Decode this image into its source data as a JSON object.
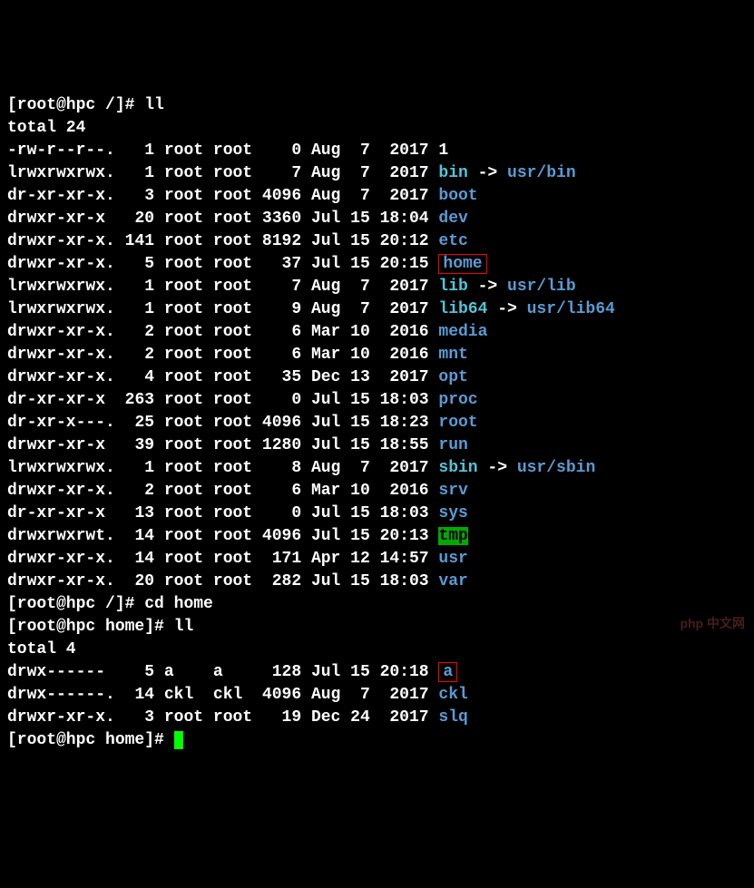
{
  "prompt1": "[root@hpc /]# ",
  "cmd1": "ll",
  "total1": "total 24",
  "rows": [
    {
      "perms": "-rw-r--r--.",
      "links": "  1",
      "owner": "root",
      "group": "root",
      "size": "   0",
      "date": "Aug  7  2017",
      "name": "1",
      "type": "plain"
    },
    {
      "perms": "lrwxrwxrwx.",
      "links": "  1",
      "owner": "root",
      "group": "root",
      "size": "   7",
      "date": "Aug  7  2017",
      "name": "bin",
      "type": "link",
      "target": "usr/bin"
    },
    {
      "perms": "dr-xr-xr-x.",
      "links": "  3",
      "owner": "root",
      "group": "root",
      "size": "4096",
      "date": "Aug  7  2017",
      "name": "boot",
      "type": "dir"
    },
    {
      "perms": "drwxr-xr-x ",
      "links": " 20",
      "owner": "root",
      "group": "root",
      "size": "3360",
      "date": "Jul 15 18:04",
      "name": "dev",
      "type": "dir"
    },
    {
      "perms": "drwxr-xr-x.",
      "links": "141",
      "owner": "root",
      "group": "root",
      "size": "8192",
      "date": "Jul 15 20:12",
      "name": "etc",
      "type": "dir"
    },
    {
      "perms": "drwxr-xr-x.",
      "links": "  5",
      "owner": "root",
      "group": "root",
      "size": "  37",
      "date": "Jul 15 20:15",
      "name": "home",
      "type": "dir-boxed"
    },
    {
      "perms": "lrwxrwxrwx.",
      "links": "  1",
      "owner": "root",
      "group": "root",
      "size": "   7",
      "date": "Aug  7  2017",
      "name": "lib",
      "type": "link",
      "target": "usr/lib"
    },
    {
      "perms": "lrwxrwxrwx.",
      "links": "  1",
      "owner": "root",
      "group": "root",
      "size": "   9",
      "date": "Aug  7  2017",
      "name": "lib64",
      "type": "link",
      "target": "usr/lib64"
    },
    {
      "perms": "drwxr-xr-x.",
      "links": "  2",
      "owner": "root",
      "group": "root",
      "size": "   6",
      "date": "Mar 10  2016",
      "name": "media",
      "type": "dir"
    },
    {
      "perms": "drwxr-xr-x.",
      "links": "  2",
      "owner": "root",
      "group": "root",
      "size": "   6",
      "date": "Mar 10  2016",
      "name": "mnt",
      "type": "dir"
    },
    {
      "perms": "drwxr-xr-x.",
      "links": "  4",
      "owner": "root",
      "group": "root",
      "size": "  35",
      "date": "Dec 13  2017",
      "name": "opt",
      "type": "dir"
    },
    {
      "perms": "dr-xr-xr-x ",
      "links": "263",
      "owner": "root",
      "group": "root",
      "size": "   0",
      "date": "Jul 15 18:03",
      "name": "proc",
      "type": "dir"
    },
    {
      "perms": "dr-xr-x---.",
      "links": " 25",
      "owner": "root",
      "group": "root",
      "size": "4096",
      "date": "Jul 15 18:23",
      "name": "root",
      "type": "dir"
    },
    {
      "perms": "drwxr-xr-x ",
      "links": " 39",
      "owner": "root",
      "group": "root",
      "size": "1280",
      "date": "Jul 15 18:55",
      "name": "run",
      "type": "dir"
    },
    {
      "perms": "lrwxrwxrwx.",
      "links": "  1",
      "owner": "root",
      "group": "root",
      "size": "   8",
      "date": "Aug  7  2017",
      "name": "sbin",
      "type": "link",
      "target": "usr/sbin"
    },
    {
      "perms": "drwxr-xr-x.",
      "links": "  2",
      "owner": "root",
      "group": "root",
      "size": "   6",
      "date": "Mar 10  2016",
      "name": "srv",
      "type": "dir"
    },
    {
      "perms": "dr-xr-xr-x ",
      "links": " 13",
      "owner": "root",
      "group": "root",
      "size": "   0",
      "date": "Jul 15 18:03",
      "name": "sys",
      "type": "dir"
    },
    {
      "perms": "drwxrwxrwt.",
      "links": " 14",
      "owner": "root",
      "group": "root",
      "size": "4096",
      "date": "Jul 15 20:13",
      "name": "tmp",
      "type": "sticky"
    },
    {
      "perms": "drwxr-xr-x.",
      "links": " 14",
      "owner": "root",
      "group": "root",
      "size": " 171",
      "date": "Apr 12 14:57",
      "name": "usr",
      "type": "dir"
    },
    {
      "perms": "drwxr-xr-x.",
      "links": " 20",
      "owner": "root",
      "group": "root",
      "size": " 282",
      "date": "Jul 15 18:03",
      "name": "var",
      "type": "dir"
    }
  ],
  "prompt2": "[root@hpc /]# ",
  "cmd2": "cd home",
  "prompt3": "[root@hpc home]# ",
  "cmd3": "ll",
  "total2": "total 4",
  "rows2": [
    {
      "perms": "drwx------ ",
      "links": "  5",
      "owner": "a   ",
      "group": "a   ",
      "size": " 128",
      "date": "Jul 15 20:18",
      "name": "a",
      "type": "dir-boxed"
    },
    {
      "perms": "drwx------.",
      "links": " 14",
      "owner": "ckl ",
      "group": "ckl ",
      "size": "4096",
      "date": "Aug  7  2017",
      "name": "ckl",
      "type": "dir"
    },
    {
      "perms": "drwxr-xr-x.",
      "links": "  3",
      "owner": "root",
      "group": "root",
      "size": "  19",
      "date": "Dec 24  2017",
      "name": "slq",
      "type": "dir"
    }
  ],
  "prompt4": "[root@hpc home]# ",
  "arrow": " -> ",
  "watermark": "php 中文网"
}
